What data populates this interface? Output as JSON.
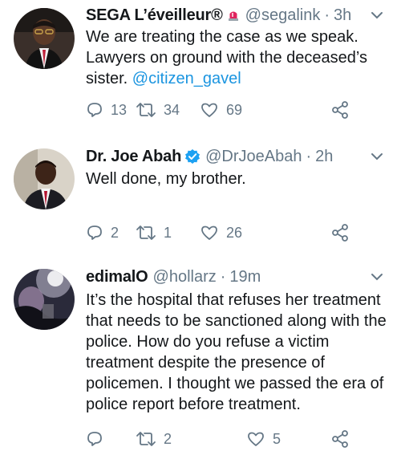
{
  "tweets": [
    {
      "name": "SEGA L’éveilleur®",
      "badge": "🚨",
      "handle": "@segalink",
      "time": "3h",
      "text": "We are treating the case as we speak. Lawyers on ground with the deceased’s sister. ",
      "mention": "@citizen_gavel",
      "replies": "13",
      "retweets": "34",
      "likes": "69"
    },
    {
      "name": "Dr. Joe Abah",
      "badge": "verified-icon",
      "handle": "@DrJoeAbah",
      "time": "2h",
      "text": "Well done, my brother.",
      "replies": "2",
      "retweets": "1",
      "likes": "26"
    },
    {
      "name": "edimalO",
      "handle": "@hollarz",
      "time": "19m",
      "text": "It’s the hospital that refuses her treatment that needs to be sanctioned along with the police. How do you refuse a victim treatment despite the presence of policemen. I thought we passed the era of police report before treatment.",
      "replies": "",
      "retweets": "2",
      "likes": "5"
    }
  ],
  "separator": "·",
  "colors": {
    "text": "#14171a",
    "muted": "#657786",
    "link": "#1b95e0",
    "verified": "#1da1f2",
    "siren": "#e0245e"
  }
}
